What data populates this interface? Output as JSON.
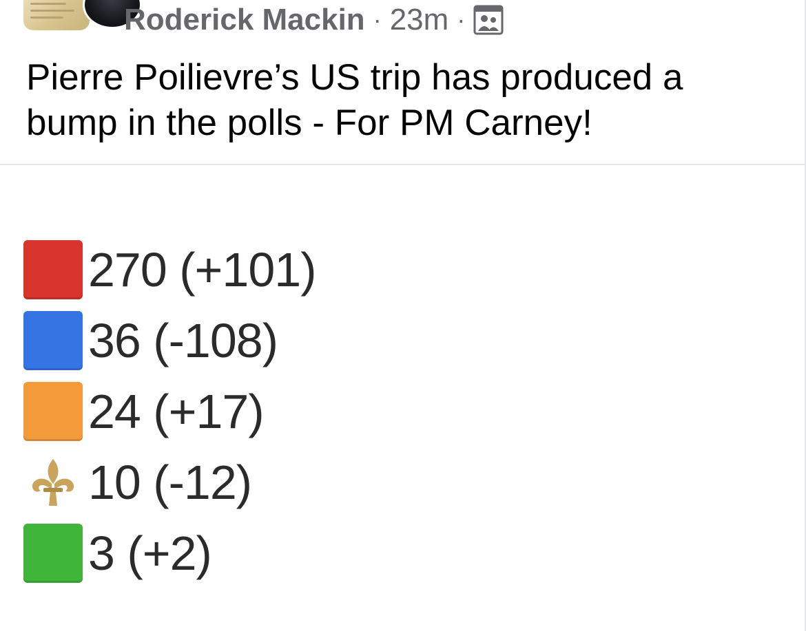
{
  "post": {
    "author": "Roderick Mackin",
    "time": "23m",
    "separator": "·",
    "audience_icon": "group-audience-icon",
    "text": "Pierre Poilievre’s US trip has produced a bump in the polls - For PM Carney!"
  },
  "results": [
    {
      "symbol": "red-square",
      "color": "#d9342b",
      "text": "270 (+101)"
    },
    {
      "symbol": "blue-square",
      "color": "#3574e3",
      "text": "36 (-108)"
    },
    {
      "symbol": "orange-square",
      "color": "#f39a3b",
      "text": "24 (+17)"
    },
    {
      "symbol": "fleur-de-lis",
      "color": "#c9a45a",
      "text": "10 (-12)"
    },
    {
      "symbol": "green-square",
      "color": "#3fb63a",
      "text": "3 (+2)"
    }
  ]
}
